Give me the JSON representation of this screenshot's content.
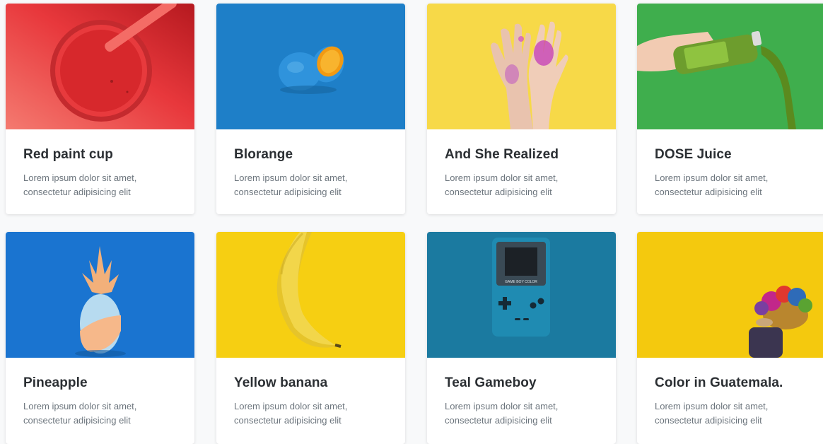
{
  "cards": [
    {
      "title": "Red paint cup",
      "line1": "Lorem ipsum dolor sit amet,",
      "line2": "consectetur adipisicing elit",
      "image": "red-paint-cup-photo",
      "color": "#e8383c"
    },
    {
      "title": "Blorange",
      "line1": "Lorem ipsum dolor sit amet,",
      "line2": "consectetur adipisicing elit",
      "image": "blue-orange-photo",
      "color": "#1e7fc8"
    },
    {
      "title": "And She Realized",
      "line1": "Lorem ipsum dolor sit amet,",
      "line2": "consectetur adipisicing elit",
      "image": "painted-hands-photo",
      "color": "#f7d948"
    },
    {
      "title": "DOSE Juice",
      "line1": "Lorem ipsum dolor sit amet,",
      "line2": "consectetur adipisicing elit",
      "image": "juice-bottle-photo",
      "color": "#3fae4d"
    },
    {
      "title": "Pineapple",
      "line1": "Lorem ipsum dolor sit amet,",
      "line2": "consectetur adipisicing elit",
      "image": "pineapple-photo",
      "color": "#1a74d0"
    },
    {
      "title": "Yellow banana",
      "line1": "Lorem ipsum dolor sit amet,",
      "line2": "consectetur adipisicing elit",
      "image": "banana-photo",
      "color": "#f6cf12"
    },
    {
      "title": "Teal Gameboy",
      "line1": "Lorem ipsum dolor sit amet,",
      "line2": "consectetur adipisicing elit",
      "image": "gameboy-photo",
      "color": "#1b7aa0"
    },
    {
      "title": "Color in Guatemala.",
      "line1": "Lorem ipsum dolor sit amet,",
      "line2": "consectetur adipisicing elit",
      "image": "guatemala-basket-photo",
      "color": "#f4c90e"
    }
  ],
  "gameboy_label": "GAME BOY COLOR"
}
